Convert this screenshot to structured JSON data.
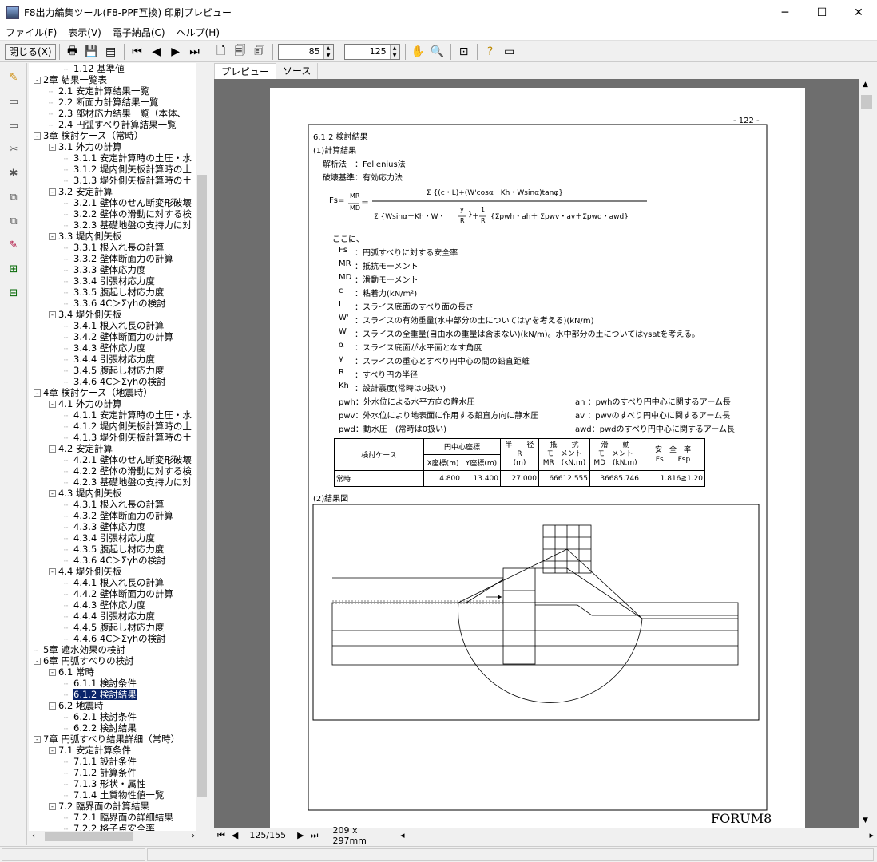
{
  "window": {
    "title": "F8出力編集ツール(F8-PPF互換) 印刷プレビュー"
  },
  "menu": [
    "ファイル(F)",
    "表示(V)",
    "電子納品(C)",
    "ヘルプ(H)"
  ],
  "toolbar": {
    "close_label": "閉じる(X)",
    "zoom_value": "85",
    "page_input_value": "125"
  },
  "tabs": [
    "プレビュー",
    "ソース"
  ],
  "tree": [
    {
      "d": 2,
      "t": "1.12 基準値"
    },
    {
      "d": 0,
      "t": "2章 結果一覧表",
      "tg": "-"
    },
    {
      "d": 1,
      "t": "2.1 安定計算結果一覧"
    },
    {
      "d": 1,
      "t": "2.2 断面力計算結果一覧"
    },
    {
      "d": 1,
      "t": "2.3 部材応力結果一覧（本体、"
    },
    {
      "d": 1,
      "t": "2.4 円弧すべり計算結果一覧"
    },
    {
      "d": 0,
      "t": "3章 検討ケース（常時）",
      "tg": "-"
    },
    {
      "d": 1,
      "t": "3.1 外力の計算",
      "tg": "-"
    },
    {
      "d": 2,
      "t": "3.1.1 安定計算時の土圧・水"
    },
    {
      "d": 2,
      "t": "3.1.2 堤内側矢板計算時の土"
    },
    {
      "d": 2,
      "t": "3.1.3 堤外側矢板計算時の土"
    },
    {
      "d": 1,
      "t": "3.2 安定計算",
      "tg": "-"
    },
    {
      "d": 2,
      "t": "3.2.1 壁体のせん断変形破壊"
    },
    {
      "d": 2,
      "t": "3.2.2 壁体の滑動に対する検"
    },
    {
      "d": 2,
      "t": "3.2.3 基礎地盤の支持力に対"
    },
    {
      "d": 1,
      "t": "3.3 堤内側矢板",
      "tg": "-"
    },
    {
      "d": 2,
      "t": "3.3.1 根入れ長の計算"
    },
    {
      "d": 2,
      "t": "3.3.2 壁体断面力の計算"
    },
    {
      "d": 2,
      "t": "3.3.3 壁体応力度"
    },
    {
      "d": 2,
      "t": "3.3.4 引張材応力度"
    },
    {
      "d": 2,
      "t": "3.3.5 腹起し材応力度"
    },
    {
      "d": 2,
      "t": "3.3.6 4C＞Σγhの検討"
    },
    {
      "d": 1,
      "t": "3.4 堤外側矢板",
      "tg": "-"
    },
    {
      "d": 2,
      "t": "3.4.1 根入れ長の計算"
    },
    {
      "d": 2,
      "t": "3.4.2 壁体断面力の計算"
    },
    {
      "d": 2,
      "t": "3.4.3 壁体応力度"
    },
    {
      "d": 2,
      "t": "3.4.4 引張材応力度"
    },
    {
      "d": 2,
      "t": "3.4.5 腹起し材応力度"
    },
    {
      "d": 2,
      "t": "3.4.6 4C＞Σγhの検討"
    },
    {
      "d": 0,
      "t": "4章 検討ケース（地震時）",
      "tg": "-"
    },
    {
      "d": 1,
      "t": "4.1 外力の計算",
      "tg": "-"
    },
    {
      "d": 2,
      "t": "4.1.1 安定計算時の土圧・水"
    },
    {
      "d": 2,
      "t": "4.1.2 堤内側矢板計算時の土"
    },
    {
      "d": 2,
      "t": "4.1.3 堤外側矢板計算時の土"
    },
    {
      "d": 1,
      "t": "4.2 安定計算",
      "tg": "-"
    },
    {
      "d": 2,
      "t": "4.2.1 壁体のせん断変形破壊"
    },
    {
      "d": 2,
      "t": "4.2.2 壁体の滑動に対する検"
    },
    {
      "d": 2,
      "t": "4.2.3 基礎地盤の支持力に対"
    },
    {
      "d": 1,
      "t": "4.3 堤内側矢板",
      "tg": "-"
    },
    {
      "d": 2,
      "t": "4.3.1 根入れ長の計算"
    },
    {
      "d": 2,
      "t": "4.3.2 壁体断面力の計算"
    },
    {
      "d": 2,
      "t": "4.3.3 壁体応力度"
    },
    {
      "d": 2,
      "t": "4.3.4 引張材応力度"
    },
    {
      "d": 2,
      "t": "4.3.5 腹起し材応力度"
    },
    {
      "d": 2,
      "t": "4.3.6 4C＞Σγhの検討"
    },
    {
      "d": 1,
      "t": "4.4 堤外側矢板",
      "tg": "-"
    },
    {
      "d": 2,
      "t": "4.4.1 根入れ長の計算"
    },
    {
      "d": 2,
      "t": "4.4.2 壁体断面力の計算"
    },
    {
      "d": 2,
      "t": "4.4.3 壁体応力度"
    },
    {
      "d": 2,
      "t": "4.4.4 引張材応力度"
    },
    {
      "d": 2,
      "t": "4.4.5 腹起し材応力度"
    },
    {
      "d": 2,
      "t": "4.4.6 4C＞Σγhの検討"
    },
    {
      "d": 0,
      "t": "5章 遮水効果の検討"
    },
    {
      "d": 0,
      "t": "6章 円弧すべりの検討",
      "tg": "-"
    },
    {
      "d": 1,
      "t": "6.1 常時",
      "tg": "-"
    },
    {
      "d": 2,
      "t": "6.1.1 検討条件"
    },
    {
      "d": 2,
      "t": "6.1.2 検討結果",
      "sel": true
    },
    {
      "d": 1,
      "t": "6.2 地震時",
      "tg": "-"
    },
    {
      "d": 2,
      "t": "6.2.1 検討条件"
    },
    {
      "d": 2,
      "t": "6.2.2 検討結果"
    },
    {
      "d": 0,
      "t": "7章 円弧すべり結果詳細（常時）",
      "tg": "-"
    },
    {
      "d": 1,
      "t": "7.1 安定計算条件",
      "tg": "-"
    },
    {
      "d": 2,
      "t": "7.1.1 設計条件"
    },
    {
      "d": 2,
      "t": "7.1.2 計算条件"
    },
    {
      "d": 2,
      "t": "7.1.3 形状・属性"
    },
    {
      "d": 2,
      "t": "7.1.4 土質物性値一覧"
    },
    {
      "d": 1,
      "t": "7.2 臨界面の計算結果",
      "tg": "-"
    },
    {
      "d": 2,
      "t": "7.2.1 臨界面の詳細結果"
    },
    {
      "d": 2,
      "t": "7.2.2 格子点安全率"
    }
  ],
  "page": {
    "page_number": "- 122 -",
    "section": "6.1.2 検討結果",
    "sub1": "(1)計算結果",
    "method": "解析法　：Fellenius法",
    "criterion": "破壊基準：有効応力法",
    "fs_lhs": "Fs=",
    "mr": "MR",
    "md": "MD",
    "eq": "＝",
    "numerator": "Σ {(c・L)+(W'cosα－Kh・Wsinα)tanφ}",
    "den_main": "Σ {Wsinα＋Kh・W・",
    "den_frac_y": "y",
    "den_frac_r": "R",
    "den_close": "}",
    "den_plus": "＋",
    "den_one": "1",
    "den_r2": "R",
    "den_tail": "{Σpwh・ah＋ Σpwv・av＋Σpwd・awd}",
    "koko": "ここに、",
    "defs": [
      [
        "Fs ",
        "：円弧すべりに対する安全率"
      ],
      [
        "MR ",
        "：抵抗モーメント"
      ],
      [
        "MD ",
        "：滑動モーメント"
      ],
      [
        "c  ",
        "：粘着力(kN/m²)"
      ],
      [
        "L  ",
        "：スライス底面のすべり面の長さ"
      ],
      [
        "W' ",
        "：スライスの有効重量(水中部分の土についてはγ'を考える)(kN/m)"
      ],
      [
        "W  ",
        "：スライスの全重量(自由水の重量は含まない)(kN/m)。水中部分の土についてはγsatを考える。"
      ],
      [
        "α  ",
        "：スライス底面が水平面となす角度"
      ],
      [
        "y  ",
        "：スライスの重心とすべり円中心の間の鉛直距離"
      ],
      [
        "R  ",
        "：すべり円の半径"
      ],
      [
        "Kh ",
        "：設計震度(常時は0扱い)"
      ]
    ],
    "defs2": [
      [
        "pwh：外水位による水平方向の静水圧",
        "ah ：pwhのすべり円中心に関するアーム長"
      ],
      [
        "pwv：外水位により地表面に作用する鉛直方向に静水圧",
        "av ：pwvのすべり円中心に関するアーム長"
      ],
      [
        "pwd：動水圧　(常時は0扱い)",
        "awd：pwdのすべり円中心に関するアーム長"
      ]
    ],
    "table": {
      "h_case": "検討ケース",
      "h_center": "円中心座標",
      "h_x": "X座標(m)",
      "h_y": "Y座標(m)",
      "h_radius": "半　　径",
      "h_radius2": "R",
      "h_radius3": "(m)",
      "h_mr": "抵　　抗",
      "h_mr2": "モーメント",
      "h_mr3": "MR　(kN.m)",
      "h_md": "滑　　動",
      "h_md2": "モーメント",
      "h_md3": "MD　(kN.m)",
      "h_fs": "安　全　率",
      "h_fs2": "Fs　　Fsp",
      "row": [
        "常時",
        "4.800",
        "13.400",
        "27.000",
        "66612.555",
        "36685.746",
        "1.816≧1.20"
      ]
    },
    "sub2": "(2)結果図",
    "logo": "FORUM8"
  },
  "nav": {
    "page_counter": "125/155",
    "paper_size": "209 x 297mm"
  }
}
